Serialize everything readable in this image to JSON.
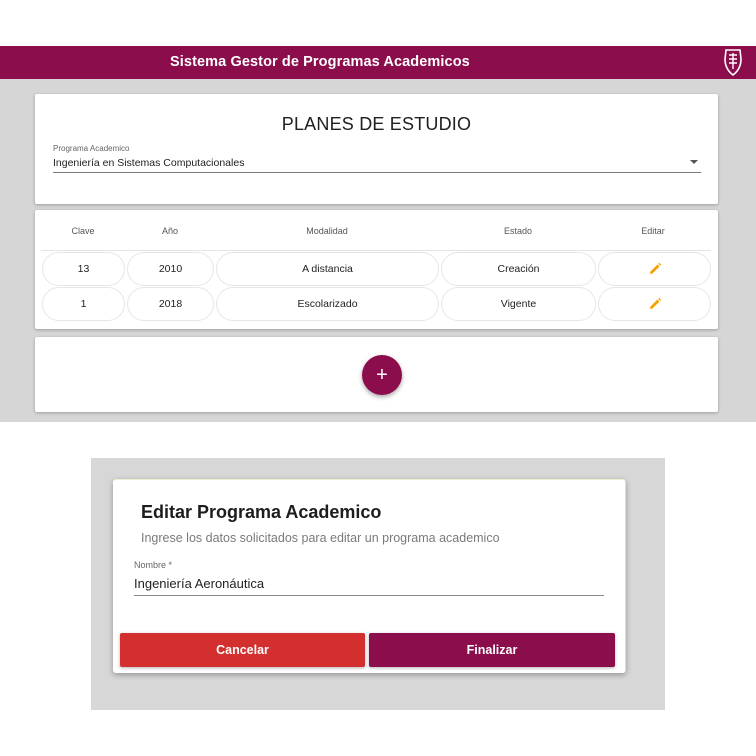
{
  "appbar": {
    "title": "Sistema Gestor de Programas Academicos"
  },
  "plans": {
    "title": "PLANES DE ESTUDIO",
    "select_label": "Programa Academico",
    "select_value": "Ingeniería en Sistemas Computacionales"
  },
  "table": {
    "headers": [
      "Clave",
      "Año",
      "Modalidad",
      "Estado",
      "Editar"
    ],
    "rows": [
      {
        "clave": "13",
        "anio": "2010",
        "modalidad": "A distancia",
        "estado": "Creación"
      },
      {
        "clave": "1",
        "anio": "2018",
        "modalidad": "Escolarizado",
        "estado": "Vigente"
      }
    ]
  },
  "fab": {
    "icon": "plus-icon",
    "label": "+"
  },
  "dialog": {
    "title": "Editar Programa Academico",
    "subtitle": "Ingrese los datos solicitados para editar un programa academico",
    "field_label": "Nombre *",
    "field_value": "Ingeniería Aeronáutica",
    "cancel_label": "Cancelar",
    "finish_label": "Finalizar"
  },
  "colors": {
    "brand": "#8b0d4b",
    "danger": "#d32f2f",
    "edit_icon": "#f5a000"
  }
}
